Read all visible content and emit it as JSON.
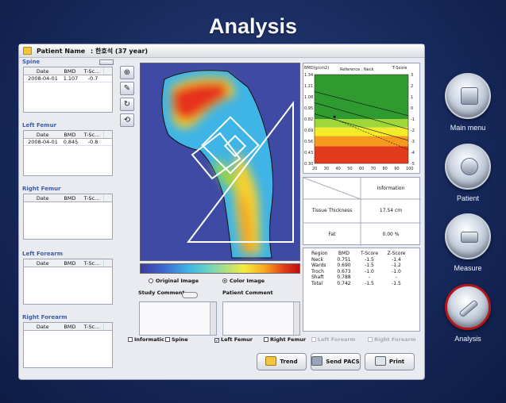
{
  "app": {
    "title": "Analysis"
  },
  "patient": {
    "label": "Patient Name",
    "value": ": 한호석 (37 year)"
  },
  "sections": {
    "spine": {
      "label": "Spine",
      "headers": [
        "Date",
        "BMD",
        "T-Sc..."
      ],
      "rows": [
        [
          "2008-04-01",
          "1.107",
          "-0.7"
        ]
      ]
    },
    "left_femur": {
      "label": "Left Femur",
      "headers": [
        "Date",
        "BMD",
        "T-Sc..."
      ],
      "rows": [
        [
          "2008-04-01",
          "0.845",
          "-0.8"
        ]
      ]
    },
    "right_femur": {
      "label": "Right Femur",
      "headers": [
        "Date",
        "BMD",
        "T-Sc..."
      ],
      "rows": []
    },
    "left_forearm": {
      "label": "Left Forearm",
      "headers": [
        "Date",
        "BMD",
        "T-Sc..."
      ],
      "rows": []
    },
    "right_forearm": {
      "label": "Right Forearm",
      "headers": [
        "Date",
        "BMD",
        "T-Sc..."
      ],
      "rows": []
    }
  },
  "tools": [
    {
      "icon": "crosshair-icon"
    },
    {
      "icon": "brush-icon"
    },
    {
      "icon": "rotate-icon"
    },
    {
      "icon": "reset-icon"
    }
  ],
  "view": {
    "original_label": "Original Image",
    "color_label": "Color Image",
    "selected": "color"
  },
  "comments": {
    "study_label": "Study Comment",
    "patient_label": "Patient Comment"
  },
  "checks": [
    {
      "label": "Informatic",
      "checked": false,
      "enabled": true
    },
    {
      "label": "Spine",
      "checked": false,
      "enabled": true
    },
    {
      "label": "Left Femur",
      "checked": true,
      "enabled": true
    },
    {
      "label": "Right Femur",
      "checked": false,
      "enabled": true
    },
    {
      "label": "Left Forearm",
      "checked": false,
      "enabled": false
    },
    {
      "label": "Right Forearm",
      "checked": false,
      "enabled": false
    }
  ],
  "chart_data": {
    "type": "line",
    "title": "",
    "top_left_label": "BMD(g/cm2)",
    "reference_label": "Reference : Neck",
    "right_axis_label": "T-Score",
    "y_left_ticks": [
      "1.34",
      "1.21",
      "1.08",
      "0.95",
      "0.82",
      "0.69",
      "0.56",
      "0.43",
      "0.30"
    ],
    "y_right_ticks": [
      "3",
      "2",
      "1",
      "0",
      "-1",
      "-2",
      "-3",
      "-4",
      "-5"
    ],
    "x_ticks": [
      "20",
      "30",
      "40",
      "50",
      "60",
      "70",
      "80",
      "90",
      "100"
    ],
    "ylim": [
      0.3,
      1.34
    ],
    "xlim": [
      20,
      100
    ],
    "bands": [
      {
        "from": 0.82,
        "to": 1.34,
        "color": "#2f9a2f"
      },
      {
        "from": 0.72,
        "to": 0.82,
        "color": "#9fd63a"
      },
      {
        "from": 0.62,
        "to": 0.72,
        "color": "#f4ec2a"
      },
      {
        "from": 0.5,
        "to": 0.62,
        "color": "#f59a1e"
      },
      {
        "from": 0.3,
        "to": 0.5,
        "color": "#e23b1c"
      }
    ],
    "series": [
      {
        "x": [
          20,
          100
        ],
        "y": [
          1.14,
          0.86
        ],
        "style": "solid"
      },
      {
        "x": [
          20,
          100
        ],
        "y": [
          1.01,
          0.7
        ],
        "style": "solid"
      },
      {
        "x": [
          20,
          100
        ],
        "y": [
          0.88,
          0.57
        ],
        "style": "solid"
      },
      {
        "x": [
          37,
          100
        ],
        "y": [
          0.82,
          0.46
        ],
        "style": "dashed"
      }
    ],
    "points": [
      {
        "x": 37,
        "y": 0.845
      }
    ]
  },
  "info": {
    "header": "Information",
    "rows": [
      {
        "label": "Tissue Thickness",
        "value": "17.54 cm"
      },
      {
        "label": "Fat",
        "value": "0.00 %"
      }
    ]
  },
  "regions": {
    "headers": [
      "Region",
      "BMD",
      "T-Score",
      "Z-Score"
    ],
    "rows": [
      [
        "Neck",
        "0.751",
        "-1.5",
        "-1.4"
      ],
      [
        "Wards",
        "0.690",
        "-1.5",
        "-1.2"
      ],
      [
        "Troch",
        "0.673",
        "-1.0",
        "-1.0"
      ],
      [
        "Shaft",
        "0.788",
        "-",
        "-"
      ],
      [
        "Total",
        "0.742",
        "-1.5",
        "-1.5"
      ]
    ]
  },
  "actions": {
    "trend": "Trend",
    "send_pacs": "Send PACS",
    "print": "Print"
  },
  "nav": [
    {
      "label": "Main menu",
      "icon": "laptop-icon",
      "active": false
    },
    {
      "label": "Patient",
      "icon": "patient-icon",
      "active": false
    },
    {
      "label": "Measure",
      "icon": "scanner-icon",
      "active": false
    },
    {
      "label": "Analysis",
      "icon": "pen-icon",
      "active": true
    }
  ]
}
